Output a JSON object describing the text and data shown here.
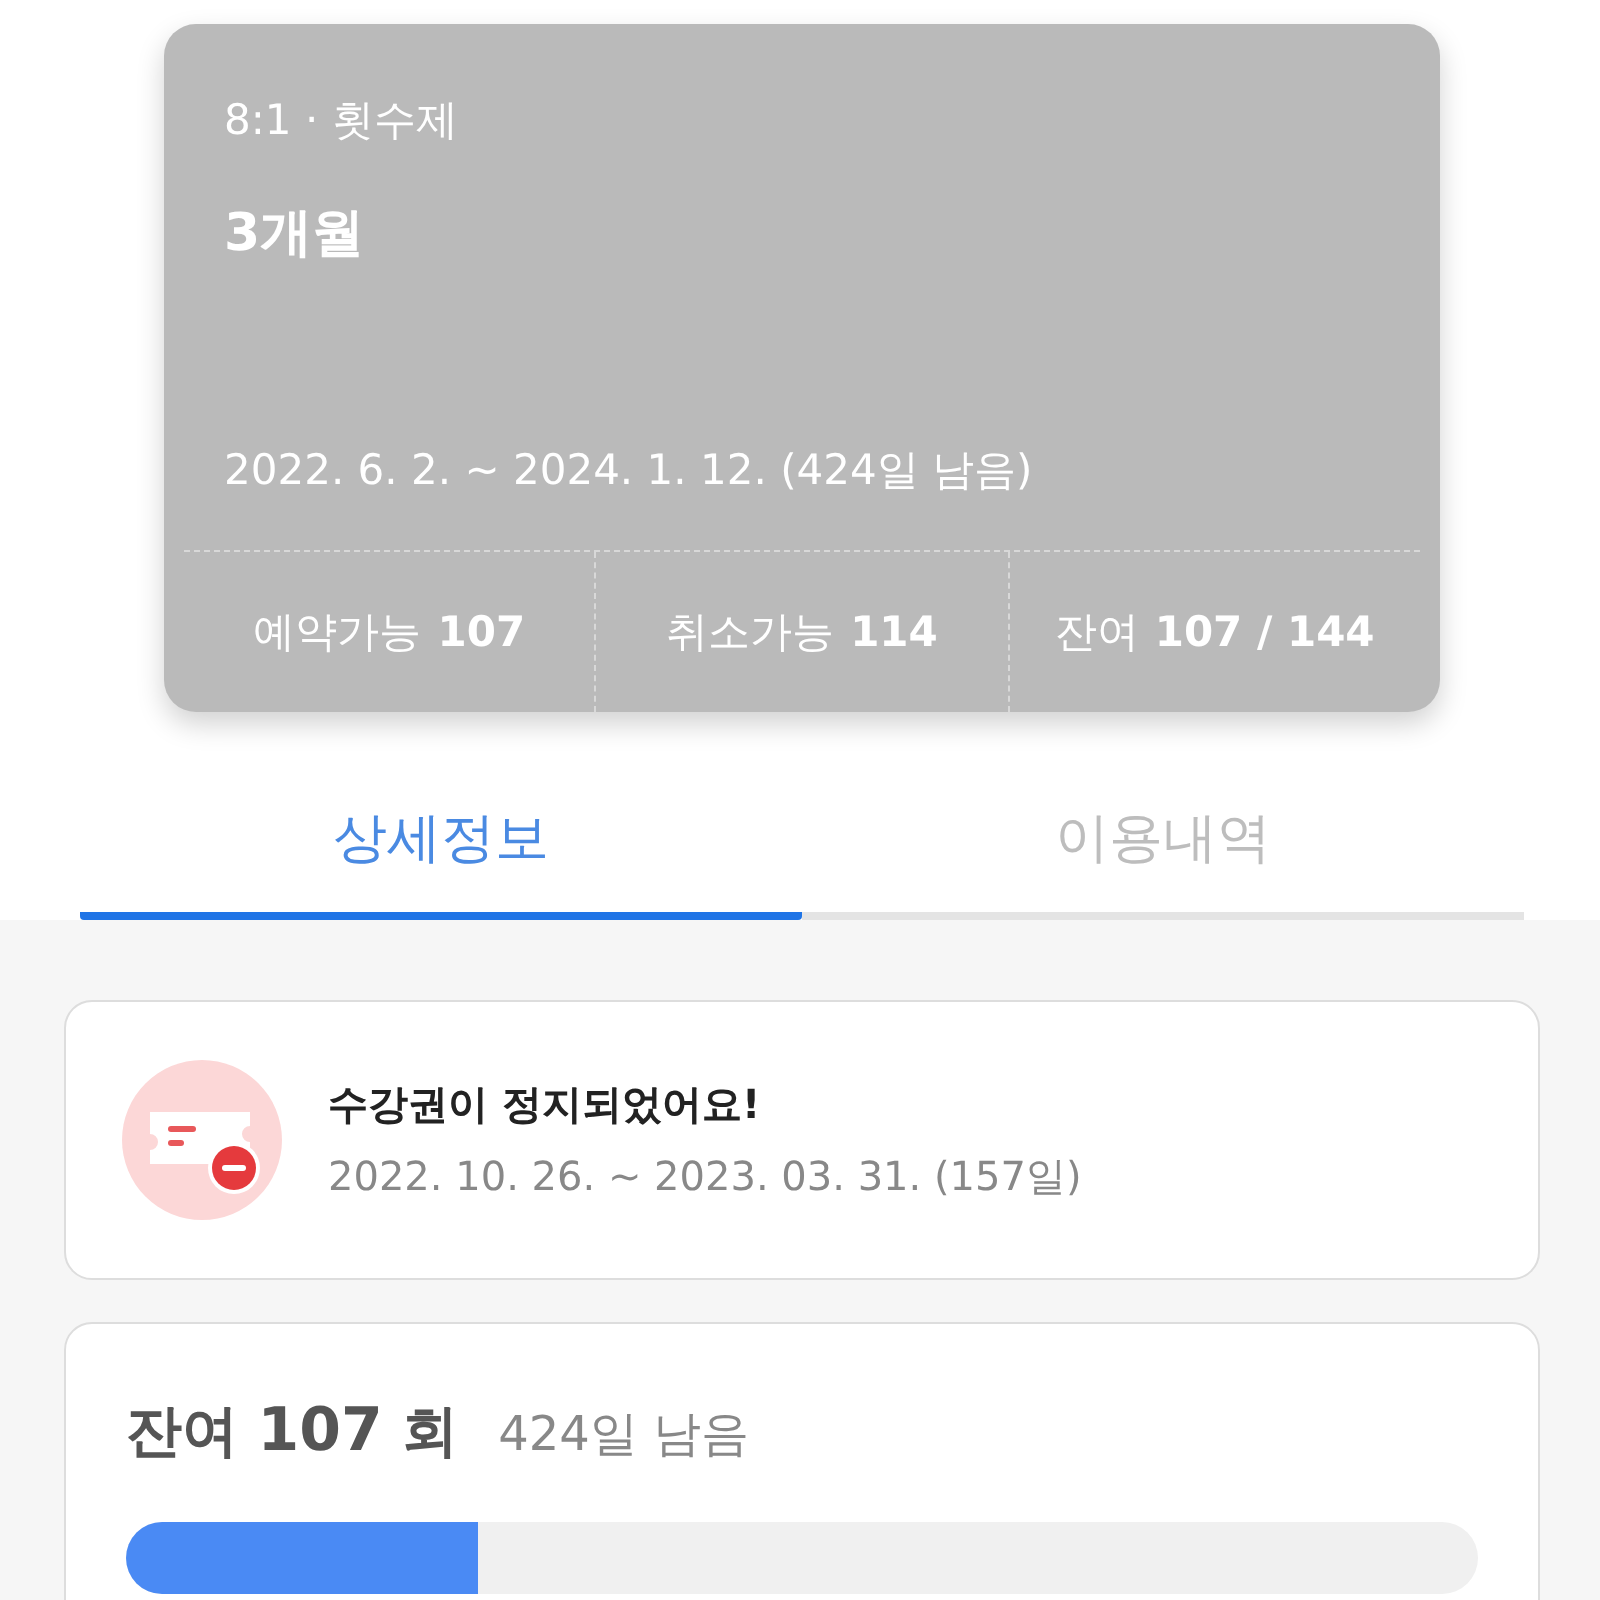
{
  "pass_card": {
    "meta": "8:1 · 횟수제",
    "title": "3개월",
    "period": "2022. 6. 2. ~ 2024. 1. 12. (424일 남음)",
    "stats": [
      {
        "label": "예약가능",
        "value": "107"
      },
      {
        "label": "취소가능",
        "value": "114"
      },
      {
        "label": "잔여",
        "value": "107 / 144"
      }
    ]
  },
  "tabs": [
    {
      "label": "상세정보",
      "selected": true
    },
    {
      "label": "이용내역",
      "selected": false
    }
  ],
  "notice": {
    "title": "수강권이 정지되었어요!",
    "period": "2022. 10. 26. ~ 2023. 03. 31. (157일)"
  },
  "remaining": {
    "title": "잔여 **107** 회",
    "days": "424일 남음",
    "progress": {
      "level": 0.26
    }
  }
}
